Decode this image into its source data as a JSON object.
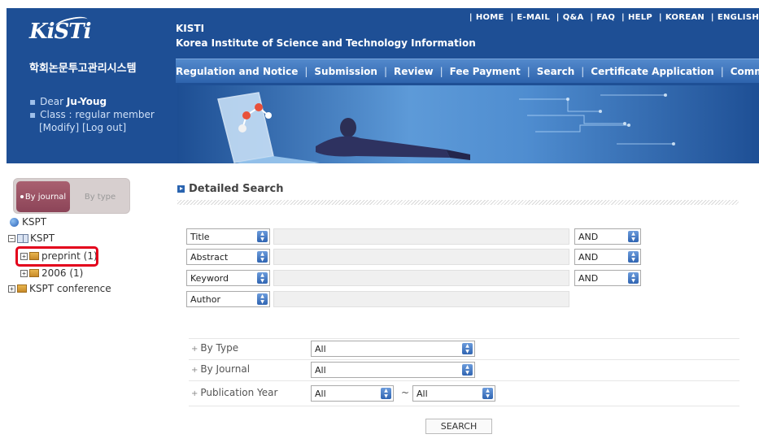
{
  "header": {
    "logo_text": "KiSTi",
    "system_name": "학회논문투고관리시스템",
    "site_name": "KISTI",
    "site_full_name": "Korea Institute of Science and Technology Information",
    "top_links": [
      "HOME",
      "E-MAIL",
      "Q&A",
      "FAQ",
      "HELP",
      "KOREAN",
      "ENGLISH"
    ],
    "nav_items": [
      "Regulation and Notice",
      "Submission",
      "Review",
      "Fee Payment",
      "Search",
      "Certificate Application",
      "Community"
    ],
    "user": {
      "greeting": "Dear",
      "name": "Ju-Youg",
      "class_label": "Class : regular member",
      "modify_link": "[Modify]",
      "logout_link": "[Log out]"
    },
    "colors": {
      "header_bg": "#1e4f95",
      "nav_bg": "#3f77bf"
    }
  },
  "sidebar": {
    "tabs": {
      "active": "By journal",
      "inactive": "By type"
    },
    "tree": {
      "root": "KSPT",
      "journal": "KSPT",
      "children": [
        {
          "label": "preprint (1)",
          "icon": "folder-icon",
          "highlighted": true
        },
        {
          "label": "2006 (1)",
          "icon": "folder-icon"
        }
      ],
      "conference": "KSPT conference"
    },
    "highlight_color": "#e3001b"
  },
  "main": {
    "title": "Detailed Search",
    "fields": [
      {
        "field": "Title",
        "operator": "AND"
      },
      {
        "field": "Abstract",
        "operator": "AND"
      },
      {
        "field": "Keyword",
        "operator": "AND"
      },
      {
        "field": "Author",
        "operator": ""
      }
    ],
    "filters": {
      "by_type_label": "By Type",
      "by_type_value": "All",
      "by_journal_label": "By Journal",
      "by_journal_value": "All",
      "year_label": "Publication Year",
      "year_from": "All",
      "year_to": "All",
      "range_sep": "~"
    },
    "search_button": "SEARCH"
  }
}
